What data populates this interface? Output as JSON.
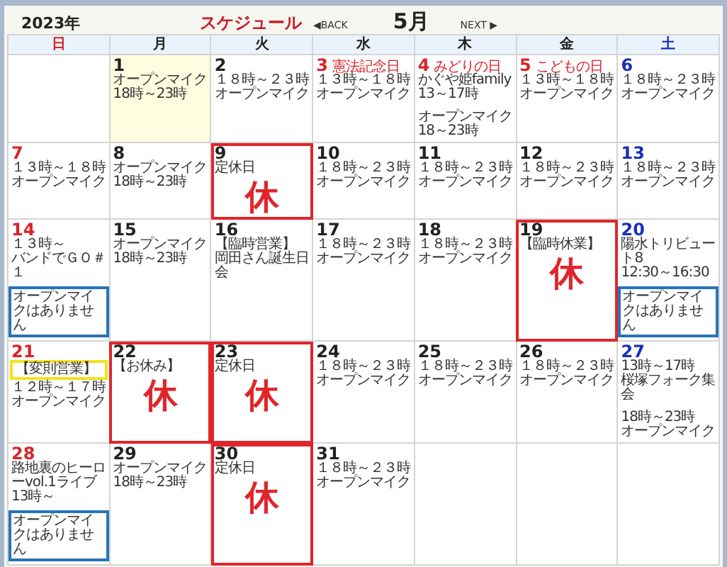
{
  "header": {
    "year": "2023年",
    "title": "スケジュール",
    "back": "◀BACK",
    "month": "5月",
    "next": "NEXT ▶"
  },
  "weekdays": [
    {
      "label": "日",
      "color": "#d9232a"
    },
    {
      "label": "月",
      "color": "#222222"
    },
    {
      "label": "火",
      "color": "#222222"
    },
    {
      "label": "水",
      "color": "#222222"
    },
    {
      "label": "木",
      "color": "#222222"
    },
    {
      "label": "金",
      "color": "#222222"
    },
    {
      "label": "土",
      "color": "#1a2fb8"
    }
  ],
  "weeks": [
    [
      {
        "kind": "blank"
      },
      {
        "kind": "day",
        "day": "1",
        "color": "#222222",
        "today": true,
        "closed": false,
        "items": [
          {
            "kind": "event",
            "lines": [
              "オープンマイク",
              "18時～23時"
            ]
          }
        ]
      },
      {
        "kind": "day",
        "day": "2",
        "color": "#222222",
        "today": false,
        "closed": false,
        "items": [
          {
            "kind": "event",
            "lines": [
              "１８時～２３時",
              "オープンマイク"
            ]
          }
        ]
      },
      {
        "kind": "day",
        "day": "3",
        "holiday": "憲法記念日",
        "color": "#d9232a",
        "today": false,
        "closed": false,
        "items": [
          {
            "kind": "event",
            "lines": [
              "１３時～１８時",
              "オープンマイク"
            ]
          }
        ]
      },
      {
        "kind": "day",
        "day": "4",
        "holiday": "みどりの日",
        "color": "#d9232a",
        "today": false,
        "closed": false,
        "items": [
          {
            "kind": "event",
            "lines": [
              "かぐや姫family",
              "13～17時"
            ]
          },
          {
            "kind": "event",
            "lines": [
              "オープンマイク",
              "18～23時"
            ]
          }
        ]
      },
      {
        "kind": "day",
        "day": "5",
        "holiday": "こどもの日",
        "color": "#d9232a",
        "today": false,
        "closed": false,
        "items": [
          {
            "kind": "event",
            "lines": [
              "１３時～１８時",
              "オープンマイク"
            ]
          }
        ]
      },
      {
        "kind": "day",
        "day": "6",
        "color": "#1a2fb8",
        "today": false,
        "closed": false,
        "items": [
          {
            "kind": "event",
            "lines": [
              "１８時～２３時",
              "オープンマイク"
            ]
          }
        ]
      }
    ],
    [
      {
        "kind": "day",
        "day": "7",
        "color": "#d9232a",
        "today": false,
        "closed": false,
        "items": [
          {
            "kind": "event",
            "lines": [
              "１３時～１８時",
              "オープンマイク"
            ]
          }
        ]
      },
      {
        "kind": "day",
        "day": "8",
        "color": "#222222",
        "today": false,
        "closed": false,
        "items": [
          {
            "kind": "event",
            "lines": [
              "オープンマイク",
              "18時～23時"
            ]
          }
        ]
      },
      {
        "kind": "day",
        "day": "9",
        "color": "#222222",
        "today": false,
        "closed": true,
        "mark": "休",
        "items": [
          {
            "kind": "event",
            "lines": [
              "定休日"
            ]
          }
        ]
      },
      {
        "kind": "day",
        "day": "10",
        "color": "#222222",
        "today": false,
        "closed": false,
        "items": [
          {
            "kind": "event",
            "lines": [
              "１８時～２３時",
              "オープンマイク"
            ]
          }
        ]
      },
      {
        "kind": "day",
        "day": "11",
        "color": "#222222",
        "today": false,
        "closed": false,
        "items": [
          {
            "kind": "event",
            "lines": [
              "１８時～２３時",
              "オープンマイク"
            ]
          }
        ]
      },
      {
        "kind": "day",
        "day": "12",
        "color": "#222222",
        "today": false,
        "closed": false,
        "items": [
          {
            "kind": "event",
            "lines": [
              "１８時～２３時",
              "オープンマイク"
            ]
          }
        ]
      },
      {
        "kind": "day",
        "day": "13",
        "color": "#1a2fb8",
        "today": false,
        "closed": false,
        "items": [
          {
            "kind": "event",
            "lines": [
              "１８時～２３時",
              "オープンマイク"
            ]
          }
        ]
      }
    ],
    [
      {
        "kind": "day",
        "day": "14",
        "color": "#d9232a",
        "today": false,
        "closed": false,
        "items": [
          {
            "kind": "event",
            "lines": [
              "１３時～",
              "バンドでＧＯ＃１"
            ]
          },
          {
            "kind": "notice",
            "text": "オープンマイクはありません"
          }
        ]
      },
      {
        "kind": "day",
        "day": "15",
        "color": "#222222",
        "today": false,
        "closed": false,
        "items": [
          {
            "kind": "event",
            "lines": [
              "オープンマイク",
              "18時～23時"
            ]
          }
        ]
      },
      {
        "kind": "day",
        "day": "16",
        "color": "#222222",
        "today": false,
        "closed": false,
        "items": [
          {
            "kind": "event",
            "lines": [
              "【臨時営業】",
              "岡田さん誕生日会"
            ]
          }
        ]
      },
      {
        "kind": "day",
        "day": "17",
        "color": "#222222",
        "today": false,
        "closed": false,
        "items": [
          {
            "kind": "event",
            "lines": [
              "１８時～２３時",
              "オープンマイク"
            ]
          }
        ]
      },
      {
        "kind": "day",
        "day": "18",
        "color": "#222222",
        "today": false,
        "closed": false,
        "items": [
          {
            "kind": "event",
            "lines": [
              "１８時～２３時",
              "オープンマイク"
            ]
          }
        ]
      },
      {
        "kind": "day",
        "day": "19",
        "color": "#222222",
        "today": false,
        "closed": true,
        "mark": "休",
        "items": [
          {
            "kind": "event",
            "lines": [
              "【臨時休業】"
            ]
          }
        ]
      },
      {
        "kind": "day",
        "day": "20",
        "color": "#1a2fb8",
        "today": false,
        "closed": false,
        "items": [
          {
            "kind": "event",
            "lines": [
              "陽水トリビュート8",
              "12:30～16:30"
            ]
          },
          {
            "kind": "notice",
            "text": "オープンマイクはありません"
          }
        ]
      }
    ],
    [
      {
        "kind": "day",
        "day": "21",
        "color": "#d9232a",
        "today": false,
        "closed": false,
        "items": [
          {
            "kind": "tag",
            "text": "【変則営業】"
          },
          {
            "kind": "event",
            "lines": [
              "１２時～１７時",
              "オープンマイク"
            ]
          }
        ]
      },
      {
        "kind": "day",
        "day": "22",
        "color": "#222222",
        "today": false,
        "closed": true,
        "mark": "休",
        "items": [
          {
            "kind": "event",
            "lines": [
              "【お休み】"
            ]
          }
        ]
      },
      {
        "kind": "day",
        "day": "23",
        "color": "#222222",
        "today": false,
        "closed": true,
        "mark": "休",
        "items": [
          {
            "kind": "event",
            "lines": [
              "定休日"
            ]
          }
        ]
      },
      {
        "kind": "day",
        "day": "24",
        "color": "#222222",
        "today": false,
        "closed": false,
        "items": [
          {
            "kind": "event",
            "lines": [
              "１８時～２３時",
              "オープンマイク"
            ]
          }
        ]
      },
      {
        "kind": "day",
        "day": "25",
        "color": "#222222",
        "today": false,
        "closed": false,
        "items": [
          {
            "kind": "event",
            "lines": [
              "１８時～２３時",
              "オープンマイク"
            ]
          }
        ]
      },
      {
        "kind": "day",
        "day": "26",
        "color": "#222222",
        "today": false,
        "closed": false,
        "items": [
          {
            "kind": "event",
            "lines": [
              "１８時～２３時",
              "オープンマイク"
            ]
          }
        ]
      },
      {
        "kind": "day",
        "day": "27",
        "color": "#1a2fb8",
        "today": false,
        "closed": false,
        "items": [
          {
            "kind": "event",
            "lines": [
              "13時～17時",
              "桜塚フォーク集会"
            ]
          },
          {
            "kind": "event",
            "lines": [
              "18時～23時",
              "オープンマイク"
            ]
          }
        ]
      }
    ],
    [
      {
        "kind": "day",
        "day": "28",
        "color": "#d9232a",
        "today": false,
        "closed": false,
        "items": [
          {
            "kind": "event",
            "lines": [
              "路地裏のヒーローvol.1ライブ",
              "13時～"
            ]
          },
          {
            "kind": "notice",
            "text": "オープンマイクはありません"
          }
        ]
      },
      {
        "kind": "day",
        "day": "29",
        "color": "#222222",
        "today": false,
        "closed": false,
        "items": [
          {
            "kind": "event",
            "lines": [
              "オープンマイク",
              "18時～23時"
            ]
          }
        ]
      },
      {
        "kind": "day",
        "day": "30",
        "color": "#222222",
        "today": false,
        "closed": true,
        "mark": "休",
        "items": [
          {
            "kind": "event",
            "lines": [
              "定休日"
            ]
          }
        ]
      },
      {
        "kind": "day",
        "day": "31",
        "color": "#222222",
        "today": false,
        "closed": false,
        "items": [
          {
            "kind": "event",
            "lines": [
              "１８時～２３時",
              "オープンマイク"
            ]
          }
        ]
      },
      {
        "kind": "blank"
      },
      {
        "kind": "blank"
      },
      {
        "kind": "blank"
      }
    ]
  ]
}
